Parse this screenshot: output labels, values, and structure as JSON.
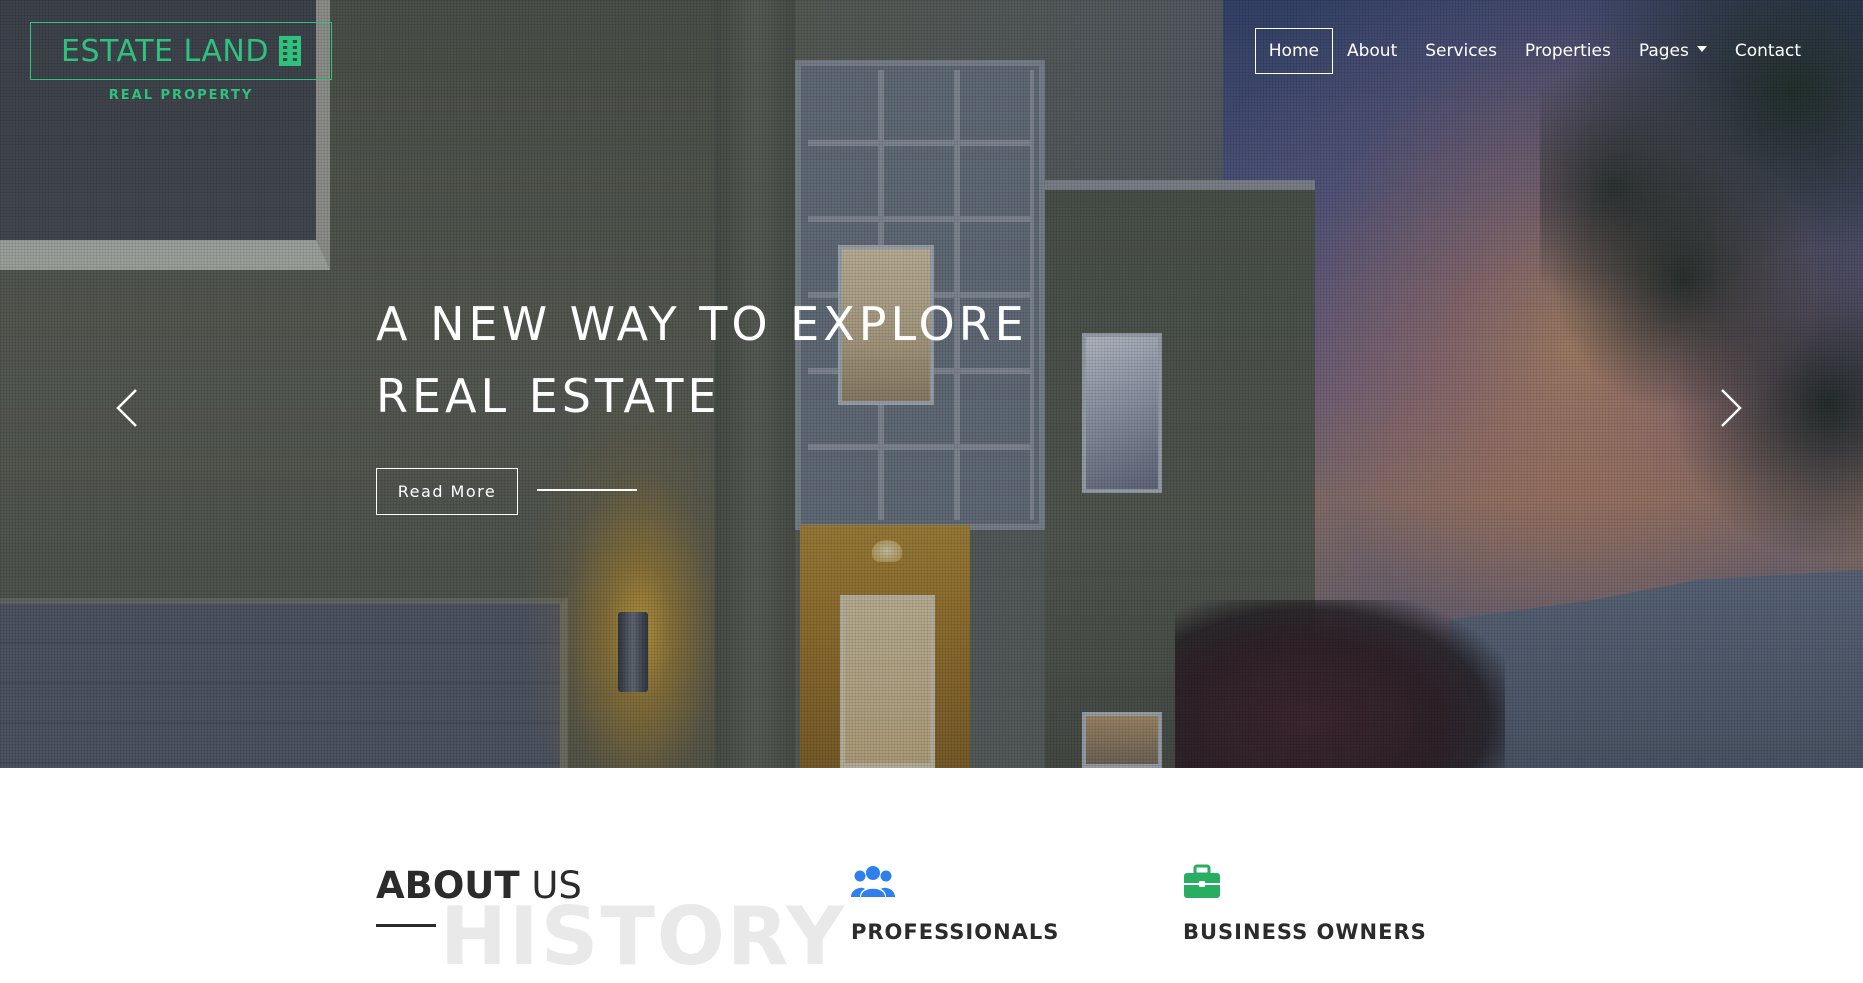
{
  "brand": {
    "name": "ESTATE LAND",
    "tagline": "REAL PROPERTY",
    "icon": "building-icon",
    "color": "#2ec27e"
  },
  "nav": {
    "items": [
      {
        "label": "Home",
        "active": true
      },
      {
        "label": "About",
        "active": false
      },
      {
        "label": "Services",
        "active": false
      },
      {
        "label": "Properties",
        "active": false
      },
      {
        "label": "Pages",
        "active": false,
        "dropdown": true
      },
      {
        "label": "Contact",
        "active": false
      }
    ]
  },
  "hero": {
    "title_line1": "A NEW WAY TO EXPLORE",
    "title_line2": "REAL ESTATE",
    "cta_label": "Read More",
    "prev_icon": "chevron-left-icon",
    "next_icon": "chevron-right-icon"
  },
  "about": {
    "heading_bold": "ABOUT",
    "heading_light": "US",
    "ghost_text": "HISTORY"
  },
  "features": [
    {
      "title": "PROFESSIONALS",
      "icon": "users-icon",
      "color": "#2f80ed"
    },
    {
      "title": "BUSINESS OWNERS",
      "icon": "briefcase-icon",
      "color": "#27ae60"
    }
  ]
}
